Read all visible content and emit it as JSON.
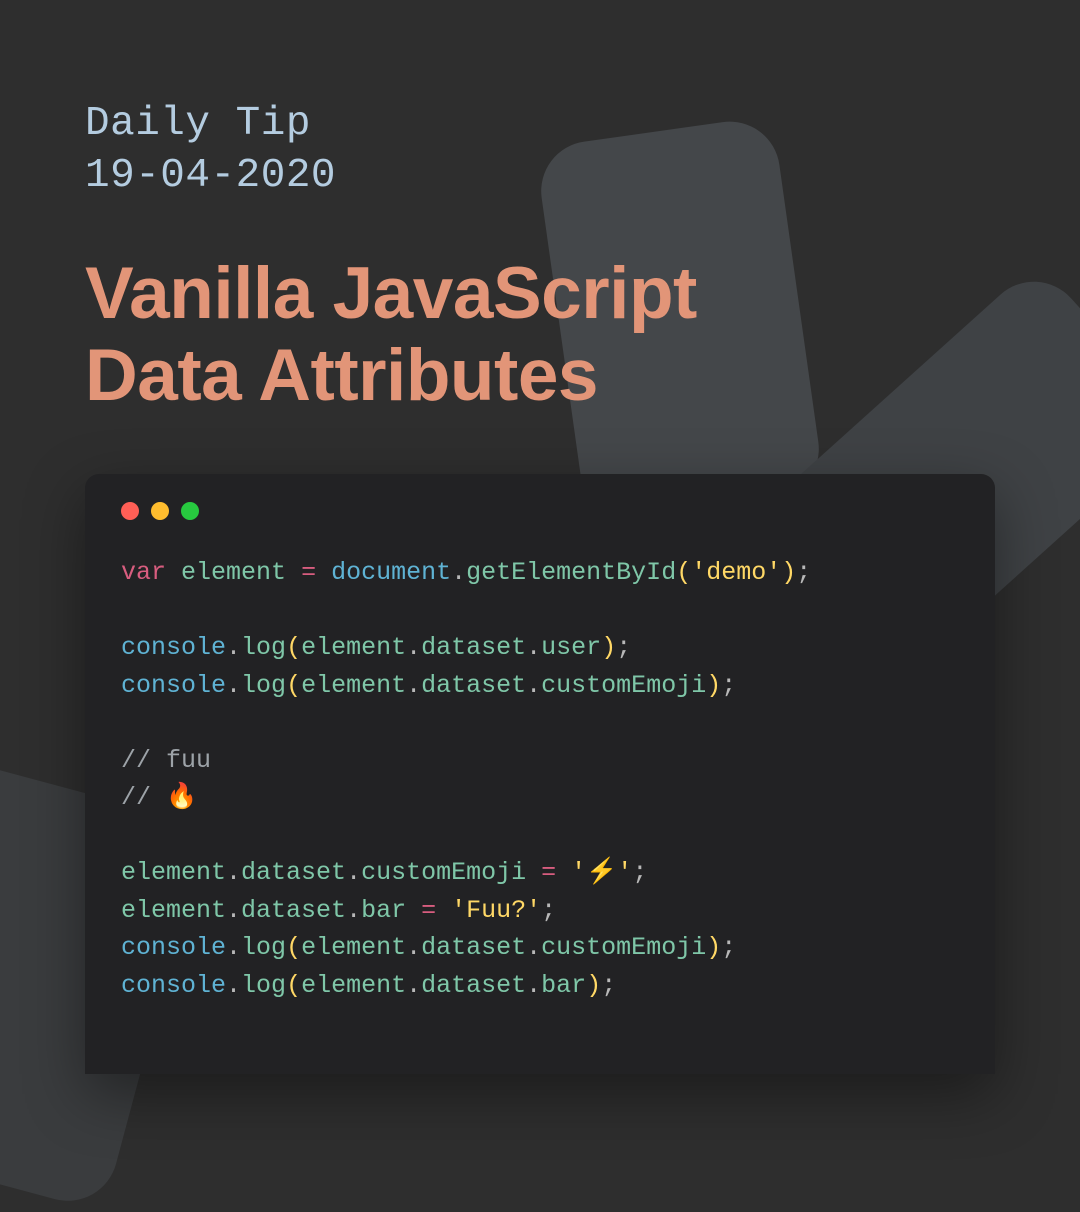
{
  "header": {
    "subtitle_line1": "Daily Tip",
    "subtitle_line2": "19-04-2020",
    "title_line1": "Vanilla JavaScript",
    "title_line2": "Data Attributes"
  },
  "code": {
    "line1": {
      "kw": "var",
      "varname": "element",
      "op": "=",
      "obj": "document",
      "method": "getElementById",
      "arg": "'demo'"
    },
    "line2": {
      "obj": "console",
      "method": "log",
      "argvar": "element",
      "p1": "dataset",
      "p2": "user"
    },
    "line3": {
      "obj": "console",
      "method": "log",
      "argvar": "element",
      "p1": "dataset",
      "p2": "customEmoji"
    },
    "line4": "// fuu",
    "line5": "// 🔥",
    "line6": {
      "varname": "element",
      "p1": "dataset",
      "p2": "customEmoji",
      "op": "=",
      "val": "'⚡'"
    },
    "line7": {
      "varname": "element",
      "p1": "dataset",
      "p2": "bar",
      "op": "=",
      "val": "'Fuu?'"
    },
    "line8": {
      "obj": "console",
      "method": "log",
      "argvar": "element",
      "p1": "dataset",
      "p2": "customEmoji"
    },
    "line9": {
      "obj": "console",
      "method": "log",
      "argvar": "element",
      "p1": "dataset",
      "p2": "bar"
    }
  }
}
